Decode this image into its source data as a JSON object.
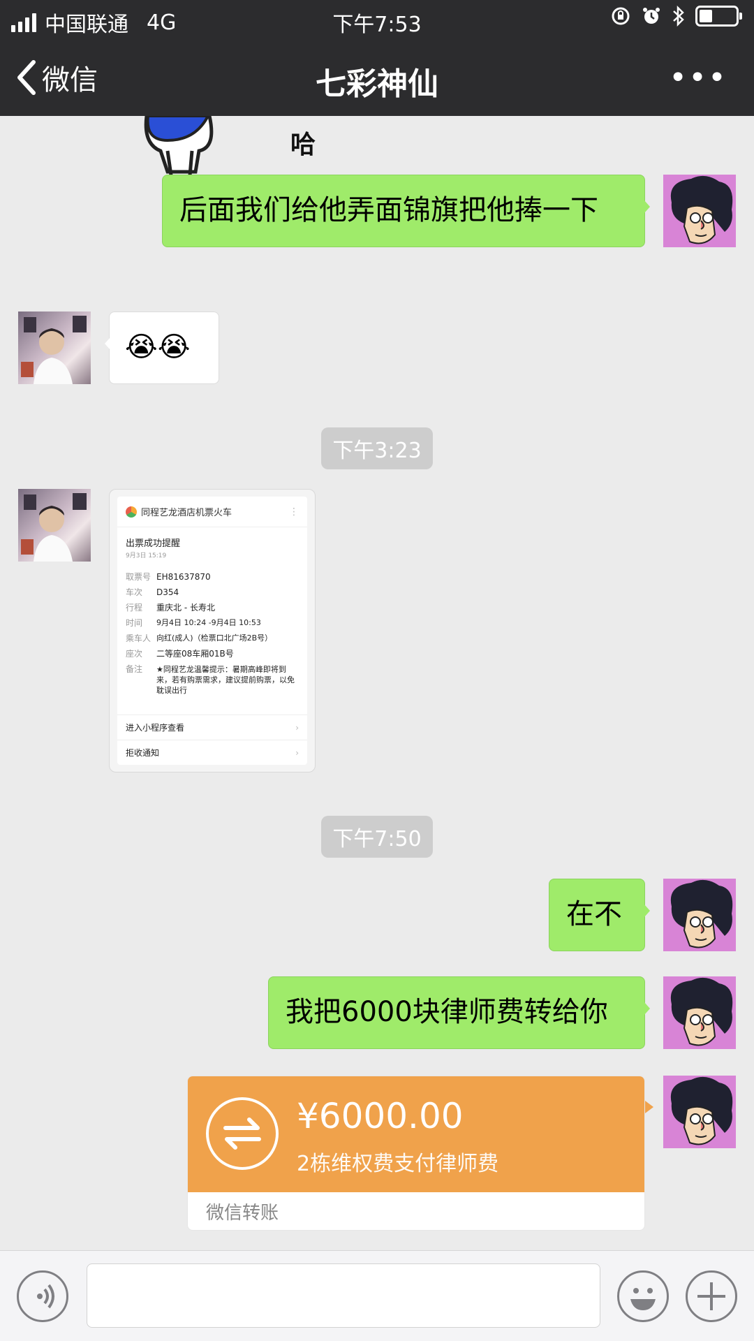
{
  "status_bar": {
    "carrier": "中国联通",
    "network": "4G",
    "time": "下午7:53",
    "battery_level": 0.35
  },
  "nav": {
    "back_label": "微信",
    "title": "七彩神仙",
    "more_label": "•••"
  },
  "chat": {
    "top_sticker_text": "哈",
    "messages": [
      {
        "side": "me",
        "text": "后面我们给他弄面锦旗把他捧一下"
      },
      {
        "side": "other",
        "text": "😭😭"
      },
      {
        "side": "me",
        "text": "在不"
      },
      {
        "side": "me",
        "text": "我把6000块律师费转给你"
      }
    ],
    "timestamps": [
      "下午3:23",
      "下午7:50"
    ],
    "ticket": {
      "app_name": "同程艺龙酒店机票火车",
      "title": "出票成功提醒",
      "date": "9月3日 15:19",
      "rows": [
        {
          "key": "取票号",
          "value": "EH81637870"
        },
        {
          "key": "车次",
          "value": "D354"
        },
        {
          "key": "行程",
          "value": "重庆北 - 长寿北"
        },
        {
          "key": "时间",
          "value": " 9月4日 10:24 -9月4日 10:53"
        },
        {
          "key": "乘车人",
          "value": "向红(成人)（检票口北广场2B号）"
        },
        {
          "key": "座次",
          "value": "二等座08车厢01B号"
        },
        {
          "key": "备注",
          "value": "★同程艺龙温馨提示：暑期高峰即将到来，若有购票需求，建议提前购票，以免耽误出行"
        }
      ],
      "link1": "进入小程序查看",
      "link2": "拒收通知"
    },
    "transfer": {
      "amount": "¥6000.00",
      "description": "2栋维权费支付律师费",
      "footer": "微信转账"
    }
  },
  "colors": {
    "nav_bg": "#2c2c2e",
    "my_bubble": "#9feb6a",
    "transfer_orange": "#f0a24b",
    "chat_bg": "#ebebeb"
  },
  "icons": [
    "back-chevron-icon",
    "more-icon",
    "voice-icon",
    "emoji-icon",
    "plus-icon",
    "transfer-icon",
    "alarm-icon",
    "bluetooth-icon",
    "rotation-lock-icon"
  ]
}
